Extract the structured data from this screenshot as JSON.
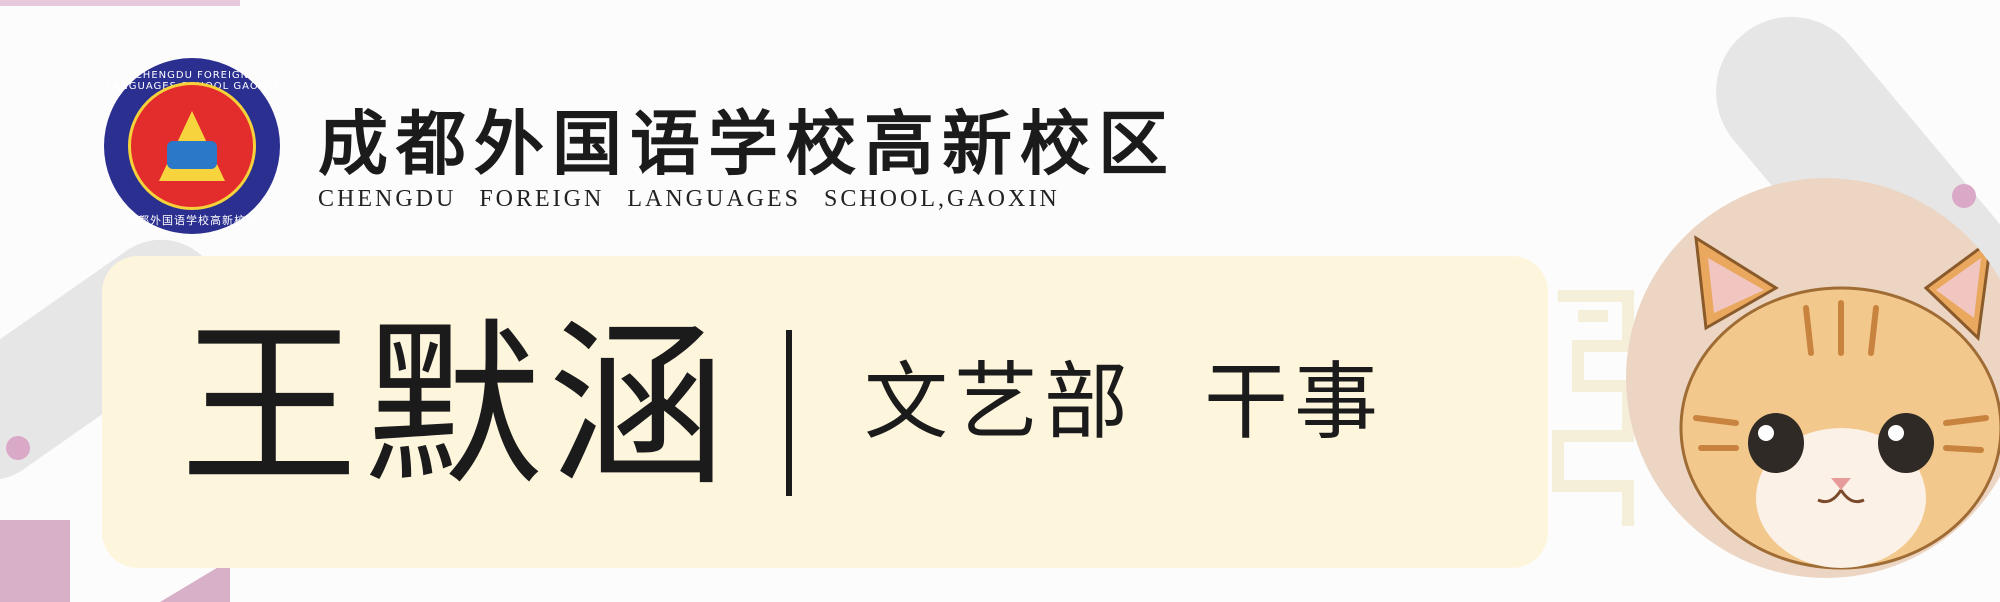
{
  "header": {
    "school_name_cn": "成都外国语学校高新校区",
    "school_name_en": "CHENGDU FOREIGN LANGUAGES SCHOOL,GAOXIN",
    "logo_text_top": "CHENGDU FOREIGN LANGUAGES SCHOOL GAOXIN",
    "logo_text_bottom": "成都外国语学校高新校区"
  },
  "card": {
    "name": "王默涵",
    "department": "文艺部",
    "position": "干事"
  },
  "avatar": {
    "icon": "kitten-illustration"
  },
  "colors": {
    "card_bg": "#fdf5dc",
    "avatar_bg": "#ecd6c3",
    "accent_pink": "#d9a9c7",
    "logo_blue": "#2b2f8f",
    "logo_red": "#e32c2c"
  }
}
